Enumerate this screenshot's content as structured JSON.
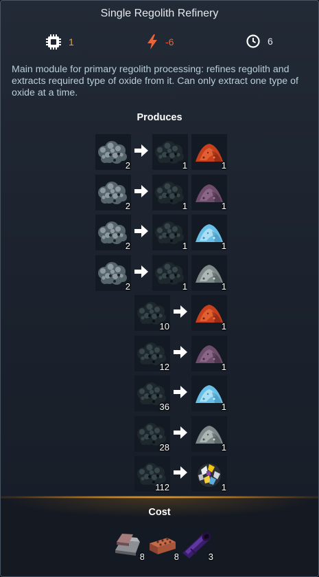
{
  "window": {
    "title": "Single Regolith Refinery"
  },
  "stats": {
    "modules": "1",
    "power": "-6",
    "time": "6",
    "colors": {
      "modules": "#e8a33a",
      "power": "#e8643a",
      "time": "#e6e9ee"
    }
  },
  "description": "Main module for primary regolith processing: refines regolith and extracts required type of oxide from it. Can only extract one type of oxide at a time.",
  "produces": {
    "heading": "Produces",
    "recipes": [
      {
        "inputs": [
          {
            "item": "regolith",
            "count": "2"
          }
        ],
        "outputs": [
          {
            "item": "refined-regolith",
            "count": "1"
          },
          {
            "item": "iron-oxide",
            "count": "1"
          }
        ]
      },
      {
        "inputs": [
          {
            "item": "regolith",
            "count": "2"
          }
        ],
        "outputs": [
          {
            "item": "refined-regolith",
            "count": "1"
          },
          {
            "item": "purple-oxide",
            "count": "1"
          }
        ]
      },
      {
        "inputs": [
          {
            "item": "regolith",
            "count": "2"
          }
        ],
        "outputs": [
          {
            "item": "refined-regolith",
            "count": "1"
          },
          {
            "item": "blue-oxide",
            "count": "1"
          }
        ]
      },
      {
        "inputs": [
          {
            "item": "regolith",
            "count": "2"
          }
        ],
        "outputs": [
          {
            "item": "refined-regolith",
            "count": "1"
          },
          {
            "item": "gray-oxide",
            "count": "1"
          }
        ]
      },
      {
        "inputs": [
          {
            "item": "refined-regolith",
            "count": "10"
          }
        ],
        "outputs": [
          {
            "item": "iron-oxide",
            "count": "1"
          }
        ]
      },
      {
        "inputs": [
          {
            "item": "refined-regolith",
            "count": "12"
          }
        ],
        "outputs": [
          {
            "item": "purple-oxide",
            "count": "1"
          }
        ]
      },
      {
        "inputs": [
          {
            "item": "refined-regolith",
            "count": "36"
          }
        ],
        "outputs": [
          {
            "item": "blue-oxide",
            "count": "1"
          }
        ]
      },
      {
        "inputs": [
          {
            "item": "refined-regolith",
            "count": "28"
          }
        ],
        "outputs": [
          {
            "item": "gray-oxide",
            "count": "1"
          }
        ]
      },
      {
        "inputs": [
          {
            "item": "refined-regolith",
            "count": "112"
          }
        ],
        "outputs": [
          {
            "item": "mixed-crystals",
            "count": "1"
          }
        ]
      }
    ]
  },
  "cost": {
    "heading": "Cost",
    "items": [
      {
        "item": "metal-ingot",
        "count": "8"
      },
      {
        "item": "bricks",
        "count": "8"
      },
      {
        "item": "purple-pipe",
        "count": "3"
      }
    ]
  }
}
